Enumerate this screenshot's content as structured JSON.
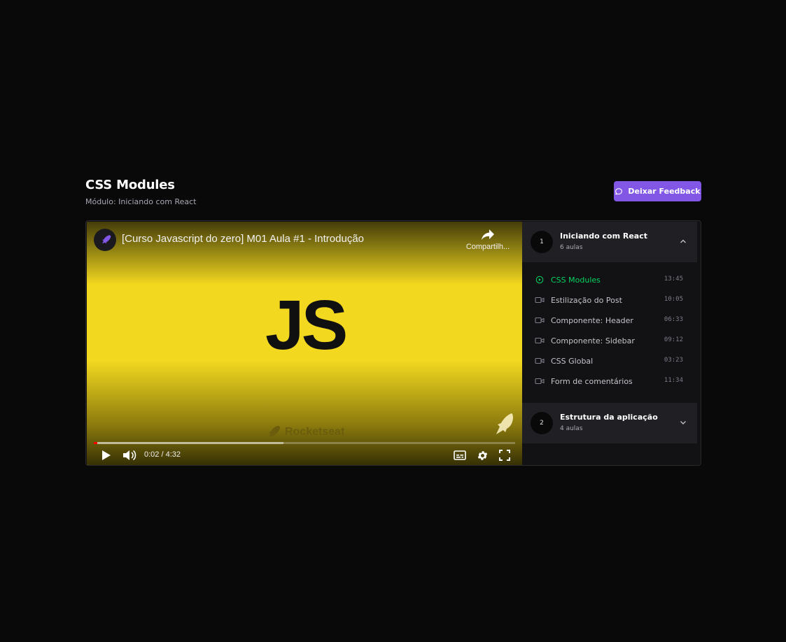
{
  "header": {
    "title": "CSS Modules",
    "subtitle": "Módulo: Iniciando com React",
    "feedback_label": "Deixar Feedback"
  },
  "video": {
    "title": "[Curso Javascript do zero] M01 Aula #1 - Introdução",
    "share_label": "Compartilh...",
    "logo_text": "JS",
    "watermark_text": "Rocketseat",
    "time_display": "0:02 / 4:32",
    "played_fraction": 0.008,
    "buffered_fraction": 0.45
  },
  "sidebar": {
    "modules": [
      {
        "number": "1",
        "title": "Iniciando com React",
        "count": "6 aulas",
        "expanded": true,
        "lessons": [
          {
            "label": "CSS Modules",
            "time": "13:45",
            "active": true,
            "icon": "play-circle-icon"
          },
          {
            "label": "Estilização do Post",
            "time": "10:05",
            "active": false,
            "icon": "video-camera-icon"
          },
          {
            "label": "Componente: Header",
            "time": "06:33",
            "active": false,
            "icon": "video-camera-icon"
          },
          {
            "label": "Componente: Sidebar",
            "time": "09:12",
            "active": false,
            "icon": "video-camera-icon"
          },
          {
            "label": "CSS Global",
            "time": "03:23",
            "active": false,
            "icon": "video-camera-icon"
          },
          {
            "label": "Form de comentários",
            "time": "11:34",
            "active": false,
            "icon": "video-camera-icon"
          }
        ]
      },
      {
        "number": "2",
        "title": "Estrutura da aplicação",
        "count": "4 aulas",
        "expanded": false
      }
    ]
  },
  "colors": {
    "background": "#09090a",
    "accent": "#8257e5",
    "active_lesson": "#04d361",
    "video_yellow": "#f2d81f",
    "progress_red": "#ff0000"
  }
}
